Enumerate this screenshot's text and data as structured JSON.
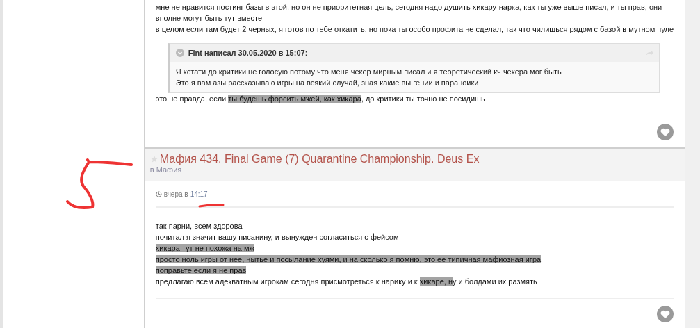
{
  "posts": [
    {
      "kind": "reply",
      "lines": [
        [
          {
            "text": "мне не нравится постинг базы в этой, но он не приоритетная цель, сегодня надо душить хикару-нарка, как ты уже выше писал, и ты прав, они",
            "marked": false
          }
        ],
        [
          {
            "text": "вполне могут быть тут вместе",
            "marked": false
          }
        ],
        [
          {
            "text": "в целом если там будет 2 черных, я готов по тебе откатить, но пока ты особо профита не сделал, так что чилишься рядом с базой в мутном пуле",
            "marked": false
          }
        ]
      ],
      "quote": {
        "author": "Fint написал 30.05.2020 в 15:07:",
        "lines": [
          "Я кстати до критики не голосую потому что меня чекер мирным писал и я теоретический кч чекера мог быть",
          "Это я вам азы рассказываю игры на всякий случай, зная какие вы гении и параноики"
        ]
      },
      "after": [
        [
          {
            "text": "это не правда, если ",
            "marked": false
          },
          {
            "text": "ты будешь форсить мжей, как хикара",
            "marked": true
          },
          {
            "text": ", до критики ты точно не посидишь",
            "marked": false
          }
        ]
      ]
    },
    {
      "kind": "thread",
      "title": "Мафия 434. Final Game (7) Quarantine Championship. Deus Ex",
      "forum": "в Мафия",
      "date": "вчера в ",
      "time": "14:17",
      "lines": [
        [
          {
            "text": "так парни, всем здорова",
            "marked": false
          }
        ],
        [
          {
            "text": "почитал я значит вашу писанину, и вынужден согласиться с фейсом",
            "marked": false
          }
        ],
        [
          {
            "text": "хикара тут не похожа на мж",
            "marked": true
          }
        ],
        [
          {
            "text": "просто ноль игры от нее, нытье и посылание хуями, и на сколько я помню, это ее типичная мафиозная игра",
            "marked": true
          }
        ],
        [
          {
            "text": "поправьте если я не прав",
            "marked": true
          }
        ],
        [
          {
            "text": "предлагаю всем адекватным игрокам сегодня присмотреться к нарику и к ",
            "marked": false
          },
          {
            "text": "хикаре, н",
            "marked": true
          },
          {
            "text": "у и болдами их размять",
            "marked": false
          }
        ]
      ]
    }
  ]
}
